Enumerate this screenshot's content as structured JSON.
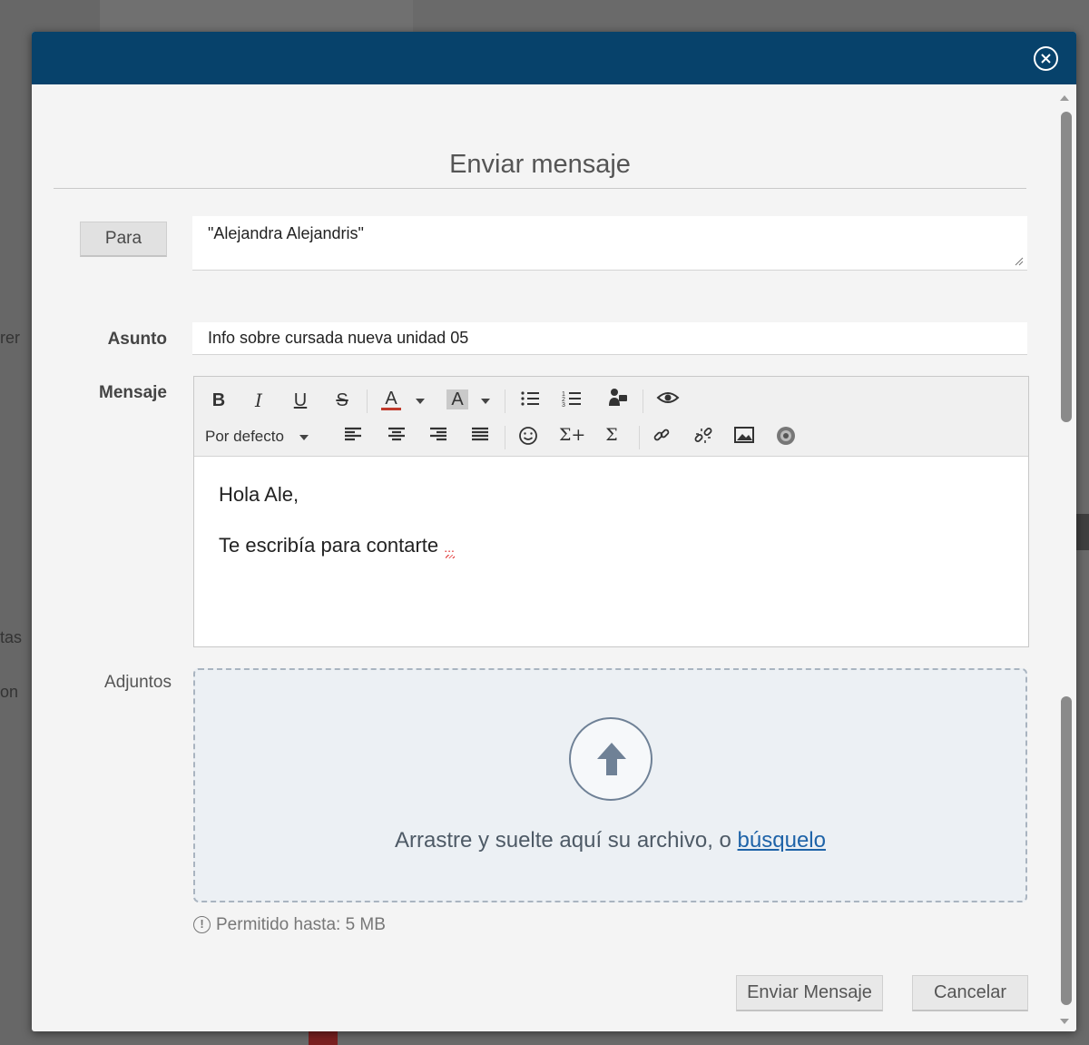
{
  "background": {
    "fragments": [
      "rer",
      "tas",
      "on"
    ]
  },
  "modal": {
    "title": "Enviar mensaje",
    "close_icon": "close-circle-icon"
  },
  "form": {
    "to_button": "Para",
    "to_value": "\"Alejandra Alejandris\"",
    "subject_label": "Asunto",
    "subject_value": "Info sobre cursada nueva unidad 05",
    "message_label": "Mensaje",
    "attachments_label": "Adjuntos"
  },
  "editor": {
    "toolbar": {
      "bold": "B",
      "italic": "I",
      "underline": "U",
      "strike": "S",
      "font_color": "A",
      "highlight": "A",
      "font_select": "Por defecto",
      "icons": [
        "bold-icon",
        "italic-icon",
        "underline-icon",
        "strikethrough-icon",
        "font-color-icon",
        "highlight-color-icon",
        "bullet-list-icon",
        "numbered-list-icon",
        "speech-icon",
        "preview-eye-icon",
        "align-left-icon",
        "align-center-icon",
        "align-right-icon",
        "align-justify-icon",
        "emoji-icon",
        "formula-icon",
        "sum-icon",
        "link-icon",
        "unlink-icon",
        "image-icon",
        "counter-icon"
      ],
      "sigma": "Σ",
      "sigma_plus": "Σ+"
    },
    "body": {
      "line1": "Hola Ale,",
      "line2": "Te escribía para contarte ",
      "line2_tail": "..."
    }
  },
  "attachments": {
    "drop_text": "Arrastre y suelte aquí su archivo, o ",
    "drop_link": "búsquelo",
    "limit": "Permitido hasta: 5 MB",
    "upload_icon": "upload-arrow-icon"
  },
  "actions": {
    "send": "Enviar Mensaje",
    "cancel": "Cancelar"
  },
  "colors": {
    "header": "#07426b",
    "link": "#1e63a8",
    "dropzone": "#ecf0f4"
  }
}
